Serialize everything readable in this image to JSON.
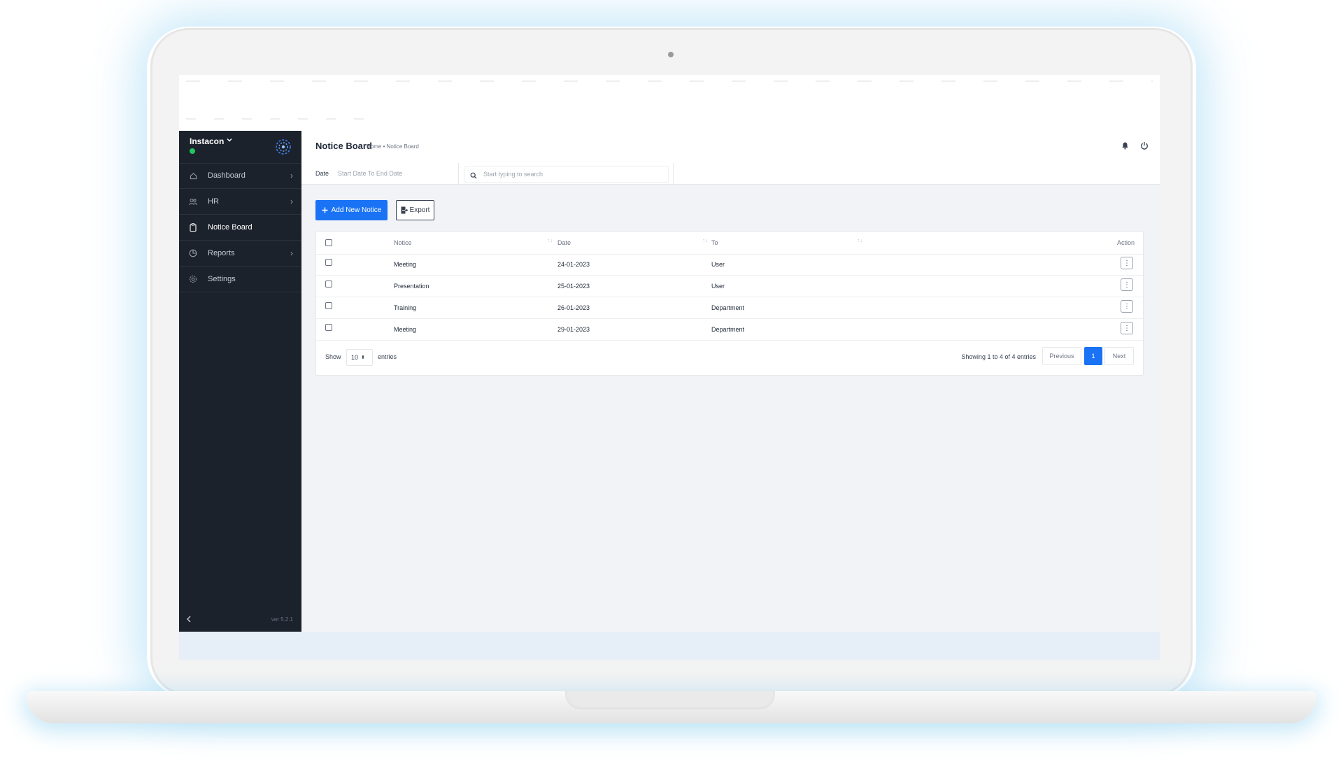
{
  "sidebar": {
    "brand": "Instacon",
    "items": [
      {
        "label": "Dashboard",
        "icon": "home-icon",
        "chevron": "›"
      },
      {
        "label": "HR",
        "icon": "users-icon",
        "chevron": "›"
      },
      {
        "label": "Notice Board",
        "icon": "clipboard-icon",
        "chevron": ""
      },
      {
        "label": "Reports",
        "icon": "pie-chart-icon",
        "chevron": "›"
      },
      {
        "label": "Settings",
        "icon": "gear-icon",
        "chevron": ""
      }
    ],
    "version": "ver 5.2.1"
  },
  "header": {
    "title": "Notice Board",
    "breadcrumb": "Home • Notice Board"
  },
  "filters": {
    "date_label": "Date",
    "date_placeholder": "Start Date To End Date",
    "search_placeholder": "Start typing to search"
  },
  "toolbar": {
    "add_label": "Add New Notice",
    "export_label": "Export"
  },
  "table": {
    "columns": [
      "Notice",
      "Date",
      "To",
      "Action"
    ],
    "rows": [
      {
        "notice": "Meeting",
        "date": "24-01-2023",
        "to": "User"
      },
      {
        "notice": "Presentation",
        "date": "25-01-2023",
        "to": "User"
      },
      {
        "notice": "Training",
        "date": "26-01-2023",
        "to": "Department"
      },
      {
        "notice": "Meeting",
        "date": "29-01-2023",
        "to": "Department"
      }
    ]
  },
  "pagination": {
    "show_label": "Show",
    "page_length": "10",
    "entries_label": "entries",
    "info": "Showing 1 to 4 of 4 entries",
    "previous": "Previous",
    "current": "1",
    "next": "Next"
  },
  "colors": {
    "sidebar_bg": "#1c222c",
    "accent": "#1a73f5",
    "online": "#22c55e"
  }
}
